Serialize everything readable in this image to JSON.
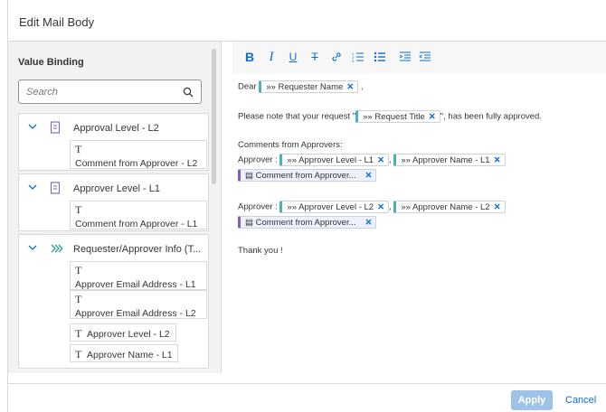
{
  "dialog": {
    "title": "Edit Mail Body"
  },
  "left": {
    "title": "Value Binding",
    "search_placeholder": "Search",
    "groups": [
      {
        "label": "Approval Level - L2",
        "leaves": [
          {
            "type_glyph": "T",
            "label": "Comment from Approver - L2"
          }
        ]
      },
      {
        "label": "Approver Level - L1",
        "leaves": [
          {
            "type_glyph": "T",
            "label": "Comment from Approver - L1"
          }
        ]
      },
      {
        "label": "Requester/Approver Info (T...",
        "leaves": [
          {
            "type_glyph": "T",
            "label": "Approver Email Address - L1"
          },
          {
            "type_glyph": "T",
            "label": "Approver Email Address - L2"
          },
          {
            "type_glyph": "T",
            "label": "Approver Level - L2"
          },
          {
            "type_glyph": "T",
            "label": "Approver Name - L1"
          }
        ]
      }
    ]
  },
  "toolbar": {
    "bold": "B",
    "italic": "I",
    "underline": "U",
    "strikethrough": "T",
    "icons": [
      "bold-icon",
      "italic-icon",
      "underline-icon",
      "strikethrough-icon",
      "link-icon",
      "numbered-list-icon",
      "bulleted-list-icon",
      "indent-icon",
      "outdent-icon"
    ]
  },
  "editor": {
    "dear_prefix": "Dear",
    "token_requester_name": "Requester Name",
    "comma": ",",
    "note_prefix": "Please note that your request \"",
    "token_request_title": "Request Title",
    "note_suffix": "\", has been fully approved.",
    "comments_heading": "Comments from Approvers:",
    "approver_prefix": "Approver :",
    "token_level_l1": "Approver Level - L1",
    "token_name_l1": "Approver Name - L1",
    "token_comment": "Comment from Approver...",
    "token_level_l2": "Approver Level - L2",
    "token_name_l2": "Approver Name - L2",
    "thanks": "Thank you !",
    "remove_glyph": "✕",
    "chevrons_glyph": "»»"
  },
  "footer": {
    "apply": "Apply",
    "cancel": "Cancel"
  }
}
